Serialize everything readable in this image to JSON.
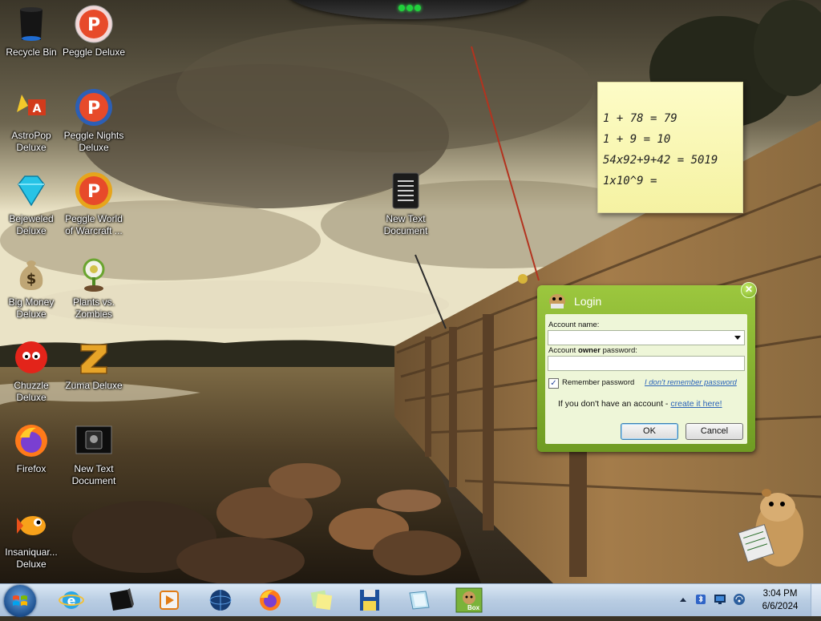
{
  "desktop": {
    "icons": [
      {
        "label": "Recycle Bin",
        "icon": "recycle-bin-icon"
      },
      {
        "label": "Peggle Deluxe",
        "icon": "peggle-icon"
      },
      {
        "label": "AstroPop\nDeluxe",
        "icon": "astropop-icon"
      },
      {
        "label": "Peggle Nights\nDeluxe",
        "icon": "peggle-nights-icon"
      },
      {
        "label": "New Text\nDocument",
        "icon": "text-document-icon"
      },
      {
        "label": "Bejeweled\nDeluxe",
        "icon": "bejeweled-icon"
      },
      {
        "label": "Peggle World\nof Warcraft ...",
        "icon": "peggle-wow-icon"
      },
      {
        "label": "Big Money\nDeluxe",
        "icon": "money-bag-icon"
      },
      {
        "label": "Plants vs.\nZombies",
        "icon": "plants-vs-zombies-icon"
      },
      {
        "label": "Chuzzle\nDeluxe",
        "icon": "chuzzle-icon"
      },
      {
        "label": "Zuma Deluxe",
        "icon": "zuma-icon"
      },
      {
        "label": "Firefox",
        "icon": "firefox-icon"
      },
      {
        "label": "New Text\nDocument",
        "icon": "text-document-dark-icon"
      },
      {
        "label": "Insaniquar...\nDeluxe",
        "icon": "insaniquarium-fish-icon"
      }
    ]
  },
  "sticky_note": {
    "lines": [
      "1 + 78 = 79",
      "1 + 9 = 10",
      "54x92+9+42 = 5019",
      "1x10^9 ="
    ]
  },
  "login_dialog": {
    "title": "Login",
    "account_name_label": "Account name:",
    "account_name_value": "",
    "password_label_pre": "Account ",
    "password_label_bold": "owner",
    "password_label_post": " password:",
    "password_value": "",
    "remember_label": "Remember password",
    "remember_checked": true,
    "forgot_link": "I don't remember password",
    "no_account_text": "If you don't have an account - ",
    "create_link": "create it here!",
    "ok_label": "OK",
    "cancel_label": "Cancel",
    "close_glyph": "✕"
  },
  "taskbar": {
    "pinned": [
      "internet-explorer-icon",
      "black-box-app-icon",
      "media-player-icon",
      "globe-icon",
      "firefox-icon",
      "sticky-notes-icon",
      "floppy-save-icon",
      "slides-icon",
      "hamster-box-icon"
    ],
    "hamster_box_label": "Box",
    "tray_icons": [
      "show-hidden-icons-chevron",
      "bluetooth-icon",
      "monitor-icon",
      "network-icon"
    ],
    "time": "3:04 PM",
    "date": "6/6/2024"
  },
  "colors": {
    "dialog_green": "#8cb733",
    "link_blue": "#2a63b8",
    "sticky_yellow": "#faf7b6",
    "taskbar_blue": "#b9cde3"
  }
}
